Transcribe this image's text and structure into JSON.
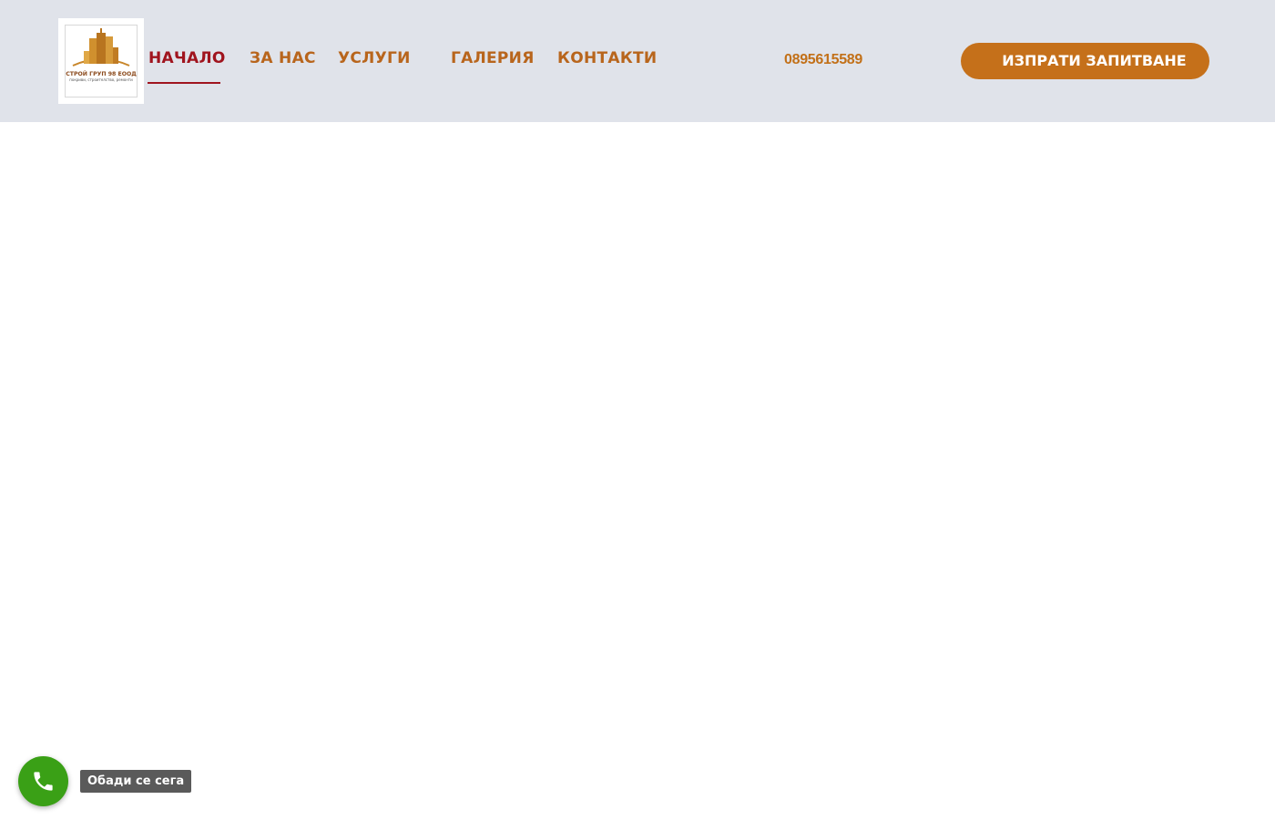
{
  "logo": {
    "company_name": "СТРОЙ ГРУП 98 ЕООД",
    "tagline": "покриви, строителство, ремонти",
    "icon": "building-logo-icon"
  },
  "nav": {
    "items": [
      {
        "label": "НАЧАЛО",
        "active": true
      },
      {
        "label": "ЗА НАС",
        "active": false
      },
      {
        "label": "УСЛУГИ",
        "active": false
      },
      {
        "label": "ГАЛЕРИЯ",
        "active": false
      },
      {
        "label": "КОНТАКТИ",
        "active": false
      }
    ]
  },
  "phone": "0895615589",
  "cta_label": "ИЗПРАТИ ЗАПИТВАНЕ",
  "call_widget": {
    "label": "Обади се сега",
    "icon": "phone-icon"
  },
  "colors": {
    "header_bg": "#e0e3ea",
    "nav_text": "#b8651c",
    "nav_active": "#a0141e",
    "cta_bg": "#c5701a",
    "call_bg": "#3aa016"
  }
}
